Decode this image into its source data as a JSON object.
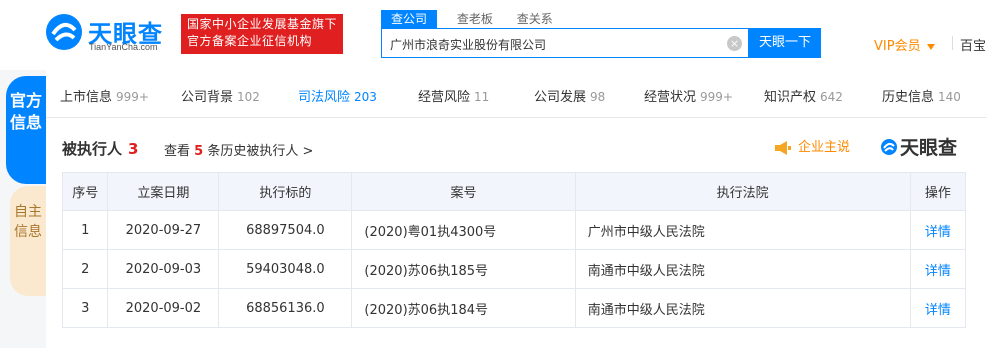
{
  "header": {
    "logo_text": "天眼查",
    "logo_sub": "TianYanCha.com",
    "gov_badge_line1": "国家中小企业发展基金旗下",
    "gov_badge_line2": "官方备案企业征信机构",
    "search_tabs": [
      "查公司",
      "查老板",
      "查关系"
    ],
    "search_value": "广州市浪奇实业股份有限公司",
    "search_button": "天眼一下",
    "vip_label": "VIP会员",
    "baibao_label": "百宝"
  },
  "side_tabs": {
    "tab1": "官方信息",
    "tab2": "自主信息"
  },
  "nav": [
    {
      "label": "上市信息",
      "count": "999+"
    },
    {
      "label": "公司背景",
      "count": "102"
    },
    {
      "label": "司法风险",
      "count": "203"
    },
    {
      "label": "经营风险",
      "count": "11"
    },
    {
      "label": "公司发展",
      "count": "98"
    },
    {
      "label": "经营状况",
      "count": "999+"
    },
    {
      "label": "知识产权",
      "count": "642"
    },
    {
      "label": "历史信息",
      "count": "140"
    }
  ],
  "section": {
    "title": "被执行人",
    "count": "3",
    "history_prefix": "查看",
    "history_num": "5",
    "history_suffix": "条历史被执行人 >",
    "ad_label": "企业主说",
    "brand": "天眼查"
  },
  "table": {
    "headers": [
      "序号",
      "立案日期",
      "执行标的",
      "案号",
      "执行法院",
      "操作"
    ],
    "rows": [
      {
        "idx": "1",
        "date": "2020-09-27",
        "amount": "68897504.0",
        "case": "(2020)粤01执4300号",
        "court": "广州市中级人民法院",
        "op": "详情"
      },
      {
        "idx": "2",
        "date": "2020-09-03",
        "amount": "59403048.0",
        "case": "(2020)苏06执185号",
        "court": "南通市中级人民法院",
        "op": "详情"
      },
      {
        "idx": "3",
        "date": "2020-09-02",
        "amount": "68856136.0",
        "case": "(2020)苏06执184号",
        "court": "南通市中级人民法院",
        "op": "详情"
      }
    ]
  },
  "colors": {
    "accent": "#0084ff",
    "danger": "#e02020",
    "vip": "#ff8a00"
  }
}
